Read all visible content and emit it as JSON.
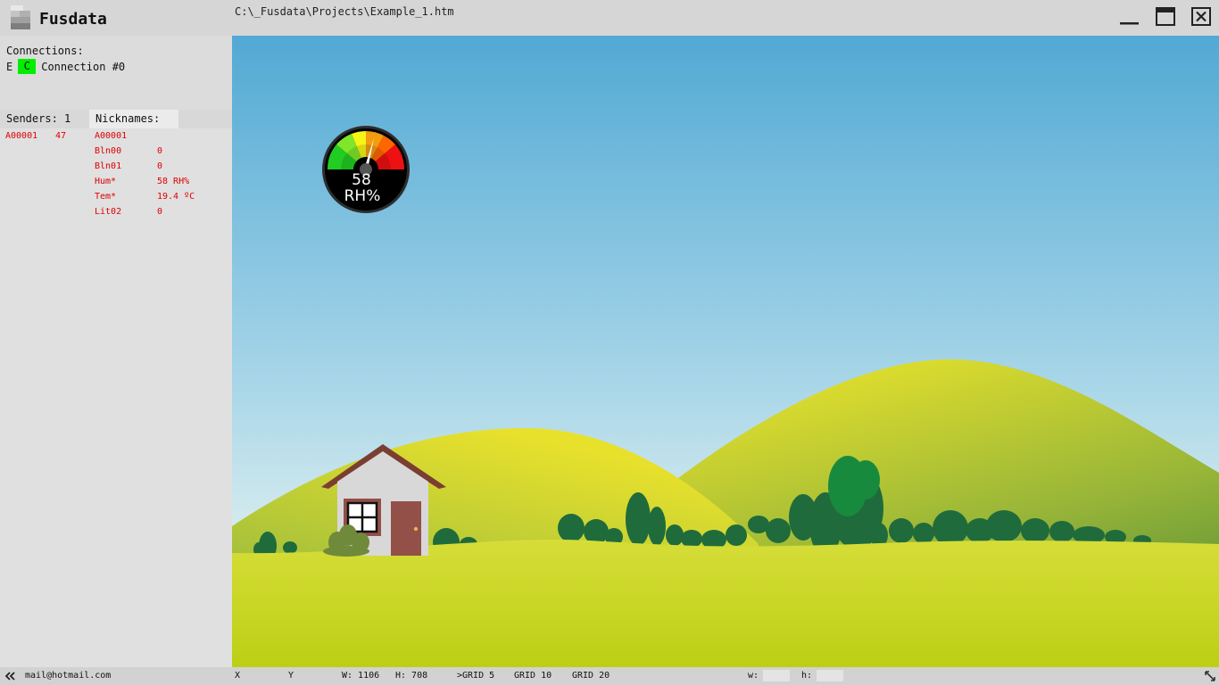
{
  "app": {
    "title": "Fusdata",
    "file_path": "C:\\_Fusdata\\Projects\\Example_1.htm"
  },
  "window_controls": [
    "minimize-icon",
    "maximize-icon",
    "close-icon"
  ],
  "connections": {
    "title": "Connections:",
    "items": [
      {
        "e_label": "E",
        "c_label": "C",
        "c_color": "#00ee00",
        "name": "Connection #0"
      }
    ]
  },
  "tabs": {
    "senders": "Senders: 1",
    "nicknames": "Nicknames:"
  },
  "senders": [
    {
      "id": "A00001",
      "count": "47"
    }
  ],
  "nicknames": {
    "header": "A00001",
    "rows": [
      {
        "name": "Bln00",
        "value": "0"
      },
      {
        "name": "Bln01",
        "value": "0"
      },
      {
        "name": "Hum*",
        "value": "58 RH%"
      },
      {
        "name": "Tem*",
        "value": "19.4 ºC"
      },
      {
        "name": "Lit02",
        "value": "0"
      }
    ]
  },
  "gauge": {
    "value": "58",
    "unit": "RH%",
    "level_fraction": 0.58
  },
  "statusbar": {
    "collapse_icon": "double-chevron-left-icon",
    "email": "mail@hotmail.com",
    "x_label": "X",
    "y_label": "Y",
    "w": "W: 1106",
    "h": "H: 708",
    "grid5": ">GRID 5",
    "grid10": "GRID 10",
    "grid20": "GRID 20",
    "w_input_label": "w:",
    "h_input_label": "h:",
    "resize_icon": "resize-diagonal-icon"
  },
  "colors": {
    "connection_active": "#00ee00",
    "data_text": "#e00000"
  }
}
